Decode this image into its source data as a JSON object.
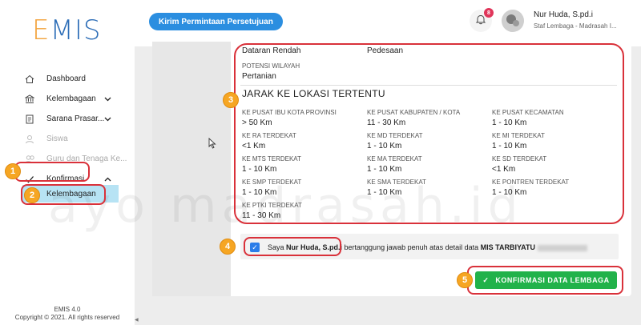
{
  "app": {
    "logo": "EMIS",
    "logo_first": "E",
    "logo_rest": "MIS",
    "footer_version": "EMIS 4.0",
    "footer_copy": "Copyright © 2021. All rights reserved"
  },
  "sidebar": {
    "items": [
      {
        "label": "Dashboard",
        "icon": "home-icon"
      },
      {
        "label": "Kelembagaan",
        "icon": "bank-icon",
        "chevron": "chevron-down-icon"
      },
      {
        "label": "Sarana Prasar...",
        "icon": "document-icon",
        "chevron": "chevron-down-icon"
      },
      {
        "label": "Siswa",
        "icon": "user-icon"
      },
      {
        "label": "Guru dan Tenaga Ke...",
        "icon": "users-icon"
      },
      {
        "label": "Konfirmasi",
        "icon": "check-icon",
        "chevron": "chevron-up-icon"
      }
    ],
    "sub_item": "Kelembagaan"
  },
  "topbar": {
    "request_button": "Kirim Permintaan Persetujuan",
    "notification_count": "8",
    "user_name": "Nur Huda, S.pd.i",
    "user_sub": "Staf Lembaga - Madrasah I..."
  },
  "content": {
    "dataran_label": "Dataran Rendah",
    "dataran_value": "Pedesaan",
    "potensi_label": "POTENSI WILAYAH",
    "potensi_value": "Pertanian",
    "section_title": "JARAK KE LOKASI TERTENTU",
    "distances": [
      {
        "label": "KE PUSAT IBU KOTA PROVINSI",
        "value": "> 50 Km"
      },
      {
        "label": "KE PUSAT KABUPATEN / KOTA",
        "value": "11 - 30 Km"
      },
      {
        "label": "KE PUSAT KECAMATAN",
        "value": "1 - 10 Km"
      },
      {
        "label": "KE RA TERDEKAT",
        "value": "<1 Km"
      },
      {
        "label": "KE MD TERDEKAT",
        "value": "1 - 10 Km"
      },
      {
        "label": "KE MI TERDEKAT",
        "value": "1 - 10 Km"
      },
      {
        "label": "KE MTS TERDEKAT",
        "value": "1 - 10 Km"
      },
      {
        "label": "KE MA TERDEKAT",
        "value": "1 - 10 Km"
      },
      {
        "label": "KE SD TERDEKAT",
        "value": "<1 Km"
      },
      {
        "label": "KE SMP TERDEKAT",
        "value": "1 - 10 Km"
      },
      {
        "label": "KE SMA TERDEKAT",
        "value": "1 - 10 Km"
      },
      {
        "label": "KE PONTREN TERDEKAT",
        "value": "1 - 10 Km"
      },
      {
        "label": "KE PTKI TERDEKAT",
        "value": "11 - 30 Km"
      }
    ],
    "confirm_prefix": "Saya ",
    "confirm_name": "Nur Huda, S.pd.i",
    "confirm_mid": " bertanggung jawab penuh atas detail data ",
    "confirm_school": "MIS TARBIYATU",
    "confirm_button": "KONFIRMASI DATA LEMBAGA"
  },
  "annotations": [
    "1",
    "2",
    "3",
    "4",
    "5"
  ],
  "watermark": "ayo madrasah.id",
  "colors": {
    "accent_blue": "#2b8ee0",
    "highlight_red": "#d9313a",
    "marker_orange": "#f6a623",
    "confirm_green": "#21b24a",
    "sub_item_bg": "#b7e3f4"
  }
}
